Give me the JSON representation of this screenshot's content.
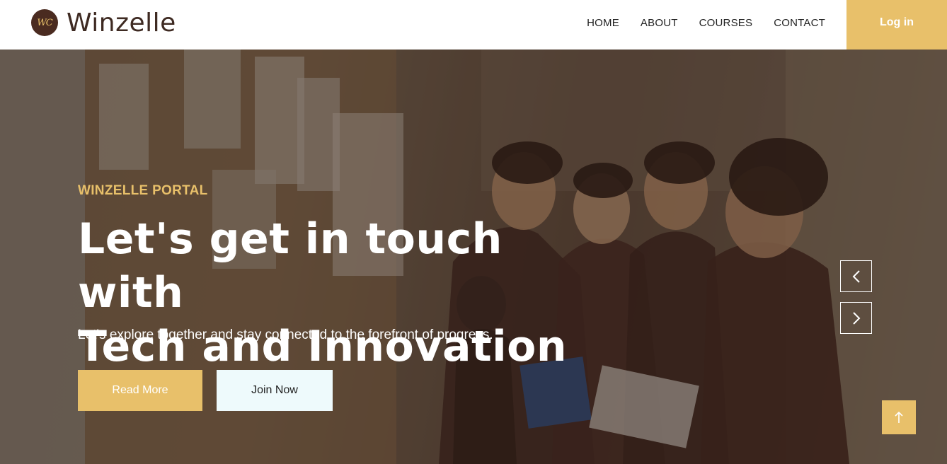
{
  "brand": {
    "logo_text": "WC",
    "name": "Winzelle"
  },
  "nav": {
    "items": [
      {
        "label": "HOME"
      },
      {
        "label": "ABOUT"
      },
      {
        "label": "COURSES"
      },
      {
        "label": "CONTACT"
      }
    ],
    "login_label": "Log in"
  },
  "hero": {
    "kicker": "WINZELLE PORTAL",
    "headline_line1": "Let's get in touch with",
    "headline_line2": "Tech and Innovation",
    "subtitle": "Let's explore together and stay connected to the forefront of progress.",
    "read_more_label": "Read More",
    "join_now_label": "Join Now"
  },
  "icons": {
    "carousel_prev": "chevron-left-icon",
    "carousel_next": "chevron-right-icon",
    "scroll_top": "arrow-up-icon"
  },
  "colors": {
    "accent": "#e8c06a",
    "brand_dark": "#4a2b20",
    "join_bg": "#eefafc"
  }
}
